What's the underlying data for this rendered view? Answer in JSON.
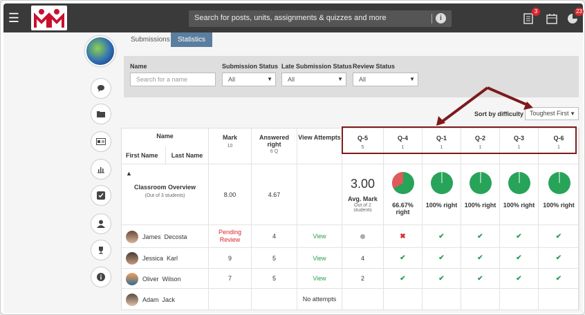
{
  "search": {
    "placeholder": "Search for posts, units, assignments & quizzes and more"
  },
  "badges": {
    "notes": "3",
    "alerts": "23"
  },
  "tabs": [
    {
      "label": "Submissions"
    },
    {
      "label": "Statistics"
    }
  ],
  "filters": {
    "name_label": "Name",
    "name_placeholder": "Search for a name",
    "submission_label": "Submission Status",
    "submission_value": "All",
    "late_label": "Late Submission Status",
    "late_value": "All",
    "review_label": "Review Status",
    "review_value": "All"
  },
  "sort": {
    "label": "Sort by difficulty",
    "value": "Toughest First"
  },
  "table": {
    "name_header": "Name",
    "first_name": "First Name",
    "last_name": "Last Name",
    "mark_header": "Mark",
    "mark_sub": "10",
    "answered_header": "Answered right",
    "answered_sub": "6 Q",
    "view_header": "View Attempts",
    "questions": [
      {
        "label": "Q-5",
        "points": "5"
      },
      {
        "label": "Q-4",
        "points": "1"
      },
      {
        "label": "Q-1",
        "points": "1"
      },
      {
        "label": "Q-2",
        "points": "1"
      },
      {
        "label": "Q-3",
        "points": "1"
      },
      {
        "label": "Q-6",
        "points": "1"
      }
    ],
    "overview": {
      "title": "Classroom Overview",
      "sub": "(Out of 3 students)",
      "mark": "8.00",
      "answered": "4.67",
      "avg": "3.00",
      "avg_label": "Avg. Mark",
      "avg_sub": "Out of 2 students",
      "q_stats": [
        {
          "text": "66.67% right",
          "pct": 0.6667
        },
        {
          "text": "100% right",
          "pct": 1
        },
        {
          "text": "100% right",
          "pct": 1
        },
        {
          "text": "100% right",
          "pct": 1
        },
        {
          "text": "100% right",
          "pct": 1
        }
      ]
    },
    "rows": [
      {
        "first": "James",
        "last": "Decosta",
        "mark": "Pending Review",
        "answered": "4",
        "view": "View",
        "q5": "",
        "marks": [
          "cross",
          "check",
          "check",
          "check",
          "check"
        ]
      },
      {
        "first": "Jessica",
        "last": "Karl",
        "mark": "9",
        "answered": "5",
        "view": "View",
        "q5": "4",
        "marks": [
          "check",
          "check",
          "check",
          "check",
          "check"
        ]
      },
      {
        "first": "Oliver",
        "last": "Wilson",
        "mark": "7",
        "answered": "5",
        "view": "View",
        "q5": "2",
        "marks": [
          "check",
          "check",
          "check",
          "check",
          "check"
        ]
      },
      {
        "first": "Adam",
        "last": "Jack",
        "mark": "",
        "answered": "",
        "view": "No attempts",
        "q5": "",
        "marks": []
      }
    ]
  },
  "colors": {
    "accent": "#5b7e9e",
    "check": "#2a9d55",
    "cross": "#d9262c",
    "pie_red": "#e05a5a",
    "pie_green": "#27a35a",
    "annotation": "#7d1a1a"
  }
}
